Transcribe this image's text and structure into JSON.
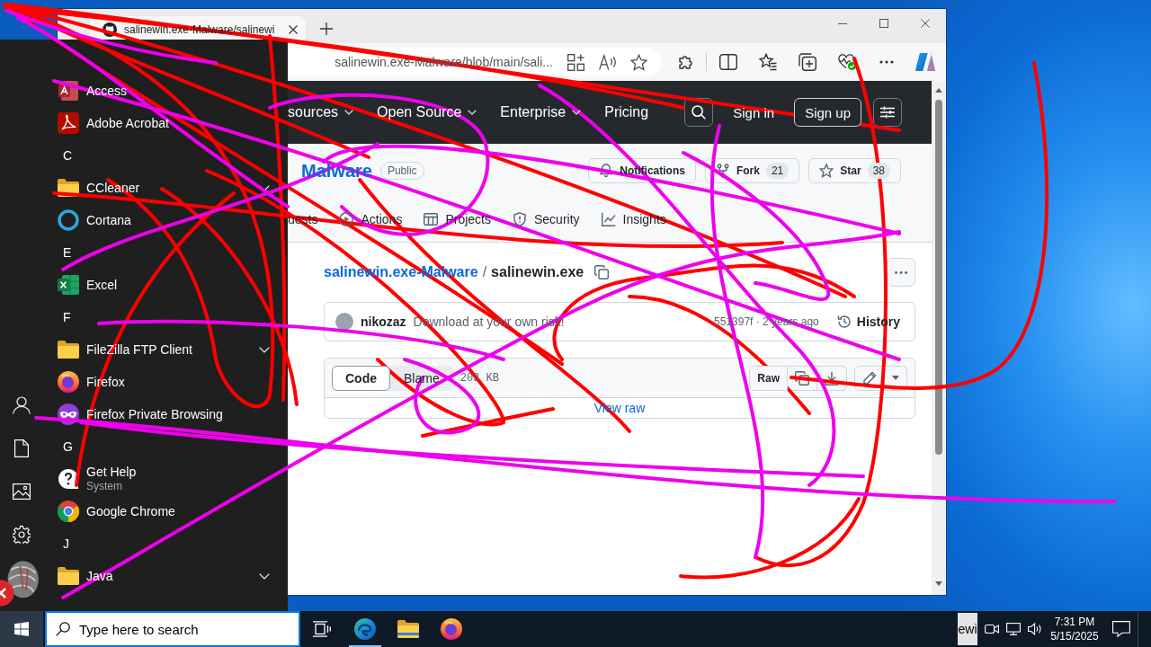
{
  "browser": {
    "tab": {
      "title": "salinewin.exe-Malware/salinewi"
    },
    "address": {
      "url": "salinewin.exe-Malware/blob/main/sali..."
    }
  },
  "github": {
    "nav": [
      {
        "label": "sources",
        "has_menu": true
      },
      {
        "label": "Open Source",
        "has_menu": true
      },
      {
        "label": "Enterprise",
        "has_menu": true
      },
      {
        "label": "Pricing",
        "has_menu": false
      }
    ],
    "sign_in": "Sign in",
    "sign_up": "Sign up",
    "repo": {
      "name": "Malware",
      "visibility": "Public"
    },
    "repo_actions": [
      {
        "kind": "notifications",
        "label": "Notifications"
      },
      {
        "kind": "fork",
        "label": "Fork",
        "count": "21"
      },
      {
        "kind": "star",
        "label": "Star",
        "count": "38"
      }
    ],
    "tabs": [
      {
        "kind": "pulls",
        "label": "uests",
        "selected": false
      },
      {
        "kind": "actions",
        "label": "Actions",
        "selected": false
      },
      {
        "kind": "projects",
        "label": "Projects",
        "selected": false
      },
      {
        "kind": "security",
        "label": "Security",
        "selected": false
      },
      {
        "kind": "insights",
        "label": "Insights",
        "selected": false
      }
    ],
    "breadcrumb": {
      "repo": "salinewin.exe-Malware",
      "separator": "/",
      "file": "salinewin.exe"
    },
    "commit": {
      "author": "nikozaz",
      "message": "Download at your own risk!",
      "meta": "551397f · 2 years ago",
      "history": "History"
    },
    "file": {
      "views": [
        {
          "label": "Code",
          "selected": true
        },
        {
          "label": "Blame",
          "selected": false
        }
      ],
      "size": "203 KB",
      "raw": "Raw",
      "body_link": "View raw"
    }
  },
  "start_menu": {
    "entries": [
      {
        "kind": "access",
        "label": "Access"
      },
      {
        "kind": "acrobat",
        "label": "Adobe Acrobat"
      },
      {
        "kind": "letter",
        "label": "C"
      },
      {
        "kind": "folder",
        "label": "CCleaner"
      },
      {
        "kind": "cortana",
        "label": "Cortana"
      },
      {
        "kind": "letter",
        "label": "E"
      },
      {
        "kind": "excel",
        "label": "Excel"
      },
      {
        "kind": "letter",
        "label": "F"
      },
      {
        "kind": "folder",
        "label": "FileZilla FTP Client"
      },
      {
        "kind": "firefox",
        "label": "Firefox"
      },
      {
        "kind": "private",
        "label": "Firefox Private Browsing"
      },
      {
        "kind": "letter",
        "label": "G"
      },
      {
        "kind": "help",
        "label": "Get Help",
        "subtitle": "System"
      },
      {
        "kind": "chrome",
        "label": "Google Chrome"
      },
      {
        "kind": "letter",
        "label": "J"
      },
      {
        "kind": "folder",
        "label": "Java"
      }
    ]
  },
  "taskbar": {
    "start_pressed": true,
    "search": {
      "placeholder": "Type here to search"
    },
    "apps": [
      {
        "kind": "task-view",
        "running": false
      },
      {
        "kind": "edge",
        "running": true
      },
      {
        "kind": "explorer",
        "running": false
      },
      {
        "kind": "firefox",
        "running": false
      }
    ],
    "tray_label": "ewi",
    "time": "7:31 PM",
    "date": "5/15/2025"
  }
}
